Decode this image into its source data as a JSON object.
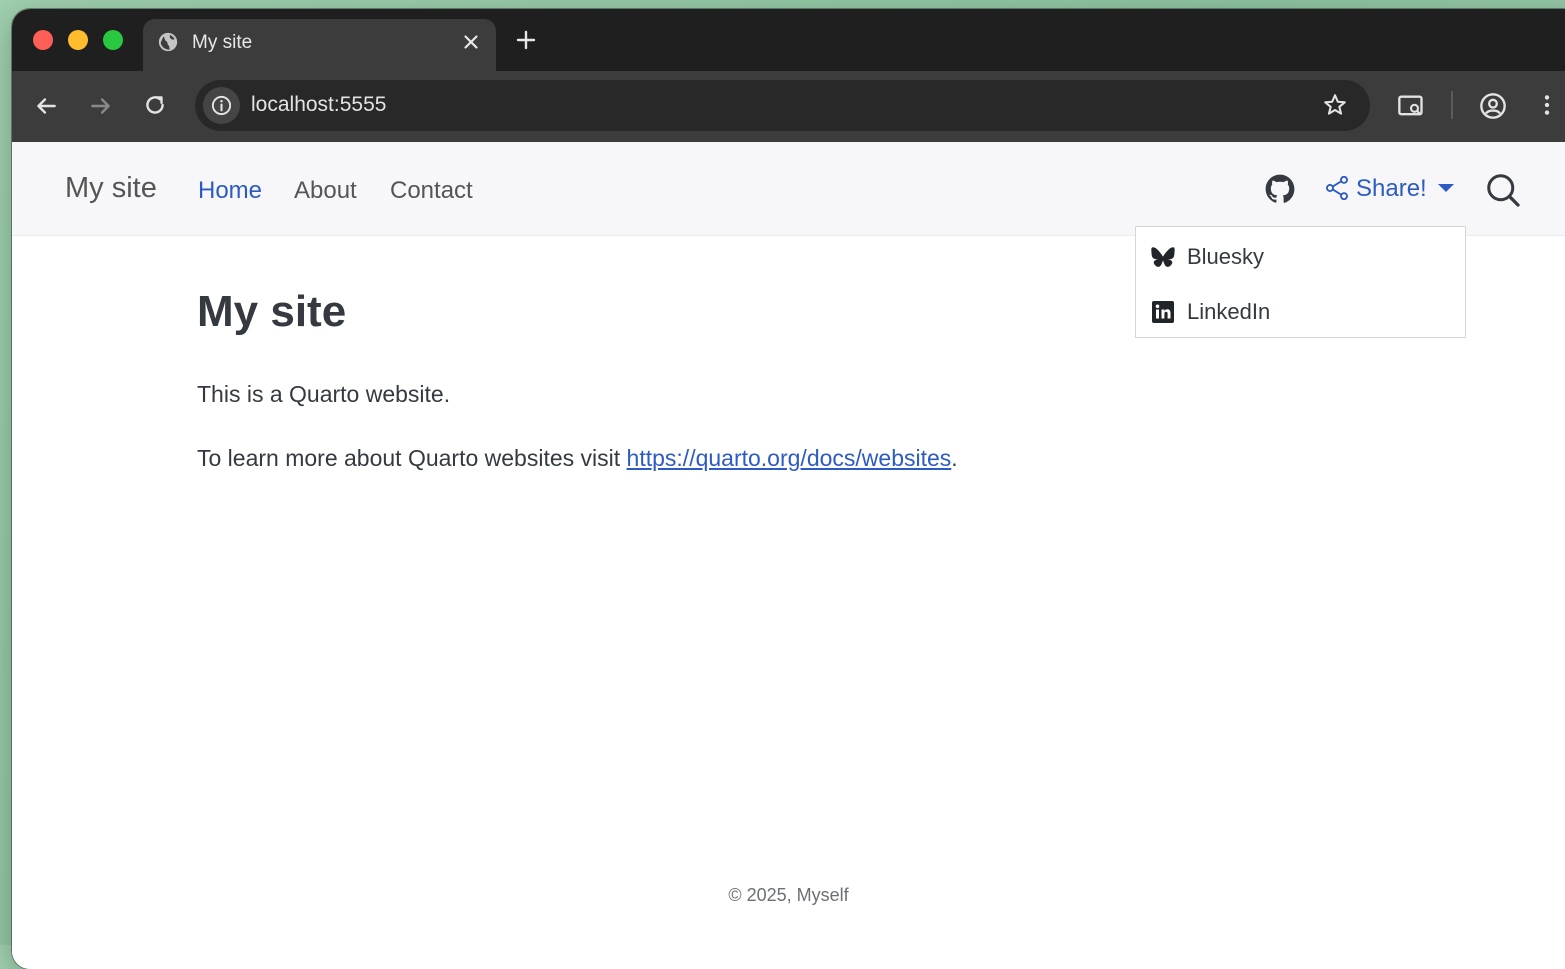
{
  "browser": {
    "tab_title": "My site",
    "url": "localhost:5555"
  },
  "navbar": {
    "brand": "My site",
    "links": [
      {
        "label": "Home"
      },
      {
        "label": "About"
      },
      {
        "label": "Contact"
      }
    ],
    "share_label": "Share!",
    "dropdown_items": [
      {
        "label": "Bluesky",
        "icon": "bluesky-icon"
      },
      {
        "label": "LinkedIn",
        "icon": "linkedin-icon"
      }
    ]
  },
  "main": {
    "heading": "My site",
    "paragraph_1": "This is a Quarto website.",
    "paragraph_2_prefix": "To learn more about Quarto websites visit ",
    "link_text": "https://quarto.org/docs/websites",
    "paragraph_2_suffix": "."
  },
  "footer": {
    "text": "© 2025, Myself"
  },
  "colors": {
    "accent_link": "#2c5bc4",
    "navbar_bg": "#f7f7f9",
    "text": "#343a40"
  }
}
